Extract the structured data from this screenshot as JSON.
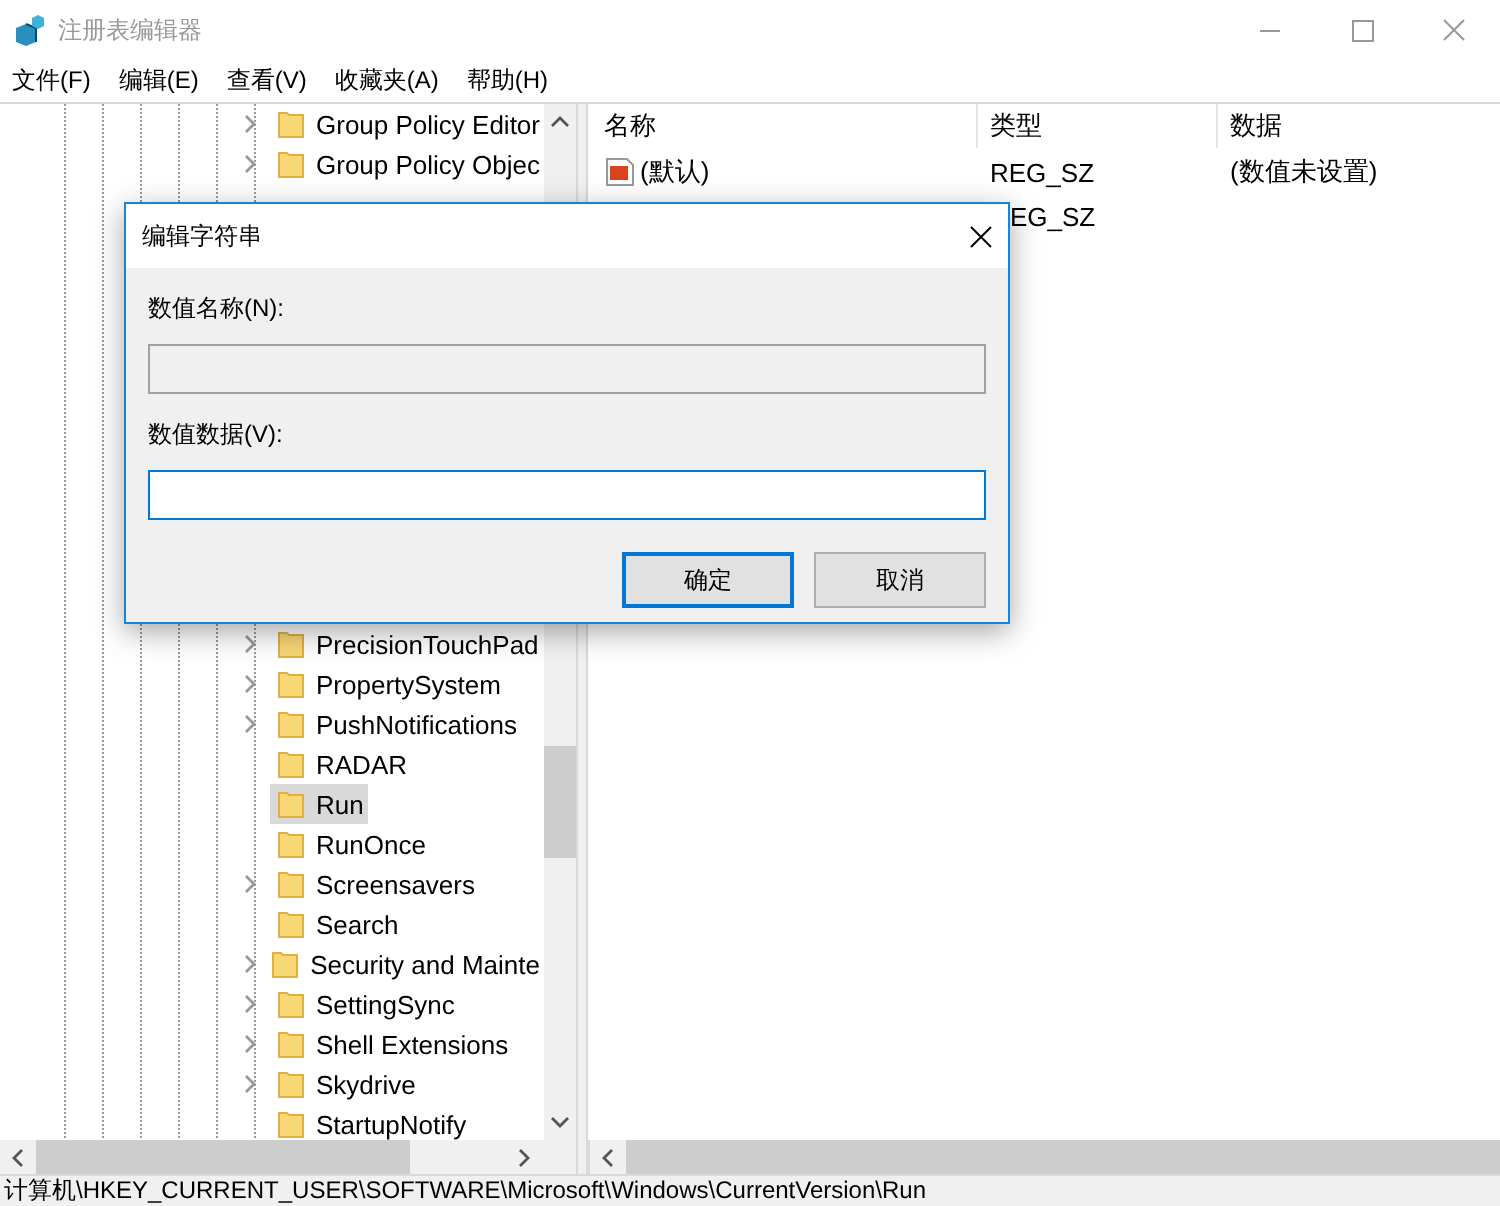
{
  "window": {
    "title": "注册表编辑器"
  },
  "menu": [
    "文件(F)",
    "编辑(E)",
    "查看(V)",
    "收藏夹(A)",
    "帮助(H)"
  ],
  "tree": {
    "top_items": [
      {
        "label": "Group Policy Editor",
        "has_children": true,
        "selected": false
      },
      {
        "label": "Group Policy Objec",
        "has_children": true,
        "selected": false
      }
    ],
    "bottom_items": [
      {
        "label": "PrecisionTouchPad",
        "has_children": true,
        "selected": false
      },
      {
        "label": "PropertySystem",
        "has_children": true,
        "selected": false
      },
      {
        "label": "PushNotifications",
        "has_children": true,
        "selected": false
      },
      {
        "label": "RADAR",
        "has_children": false,
        "selected": false
      },
      {
        "label": "Run",
        "has_children": false,
        "selected": true
      },
      {
        "label": "RunOnce",
        "has_children": false,
        "selected": false
      },
      {
        "label": "Screensavers",
        "has_children": true,
        "selected": false
      },
      {
        "label": "Search",
        "has_children": false,
        "selected": false
      },
      {
        "label": "Security and Mainte",
        "has_children": true,
        "selected": false
      },
      {
        "label": "SettingSync",
        "has_children": true,
        "selected": false
      },
      {
        "label": "Shell Extensions",
        "has_children": true,
        "selected": false
      },
      {
        "label": "Skydrive",
        "has_children": true,
        "selected": false
      },
      {
        "label": "StartupNotify",
        "has_children": false,
        "selected": false
      }
    ]
  },
  "list": {
    "columns": [
      "名称",
      "类型",
      "数据"
    ],
    "rows": [
      {
        "name": "(默认)",
        "type": "REG_SZ",
        "data": "(数值未设置)"
      },
      {
        "type": "EG_SZ"
      }
    ]
  },
  "dialog": {
    "title": "编辑字符串",
    "name_label": "数值名称(N):",
    "name_field": {
      "disabled": true
    },
    "data_label": "数值数据(V):",
    "data_field": {
      "focused": true
    },
    "buttons": [
      {
        "label": "确定",
        "default": true
      },
      {
        "label": "取消",
        "default": false
      }
    ]
  },
  "status_bar": "计算机\\HKEY_CURRENT_USER\\SOFTWARE\\Microsoft\\Windows\\CurrentVersion\\Run"
}
